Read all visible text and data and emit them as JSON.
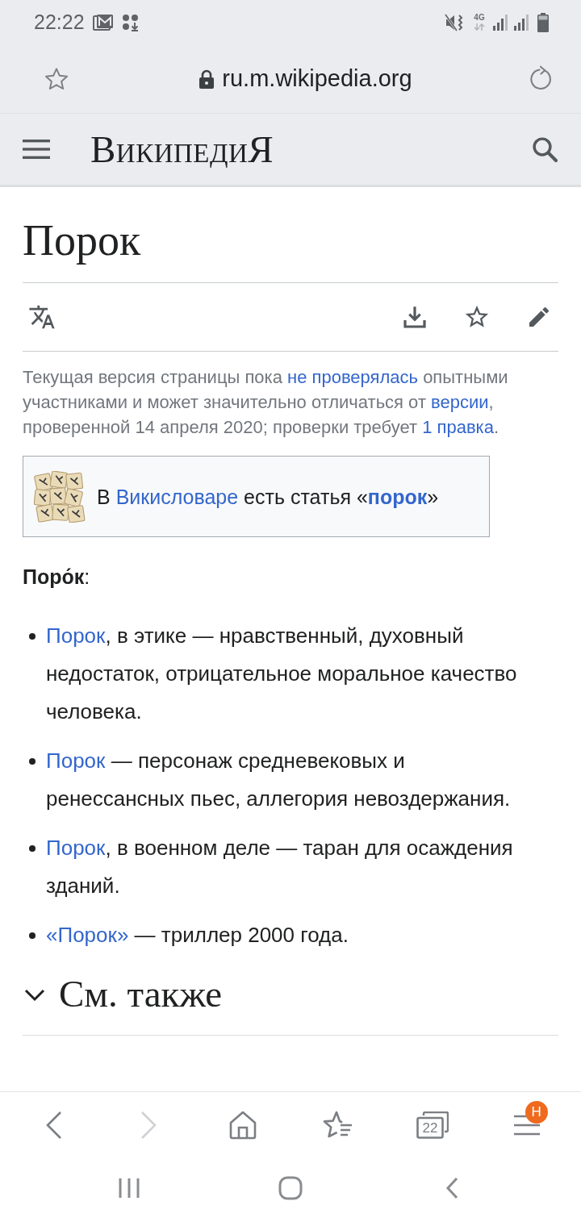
{
  "status_bar": {
    "time": "22:22",
    "network": "4G"
  },
  "address_bar": {
    "url": "ru.m.wikipedia.org"
  },
  "wiki_header": {
    "logo": "ВикипедиЯ"
  },
  "article": {
    "title": "Порок",
    "notice": [
      {
        "kind": "text",
        "text": "Текущая версия страницы пока "
      },
      {
        "kind": "link",
        "text": "не проверялась"
      },
      {
        "kind": "text",
        "text": " опытными участниками и может значительно отличаться от "
      },
      {
        "kind": "link",
        "text": "версии"
      },
      {
        "kind": "text",
        "text": ", проверенной 14 апреля 2020; проверки требует "
      },
      {
        "kind": "link",
        "text": "1 правка"
      },
      {
        "kind": "text",
        "text": "."
      }
    ],
    "wiktionary_box": [
      {
        "kind": "text",
        "text": "В "
      },
      {
        "kind": "link",
        "text": "Викисловаре"
      },
      {
        "kind": "text",
        "text": " есть статья «"
      },
      {
        "kind": "bold_link",
        "text": "порок"
      },
      {
        "kind": "text",
        "text": "»"
      }
    ],
    "definition": "**Поро́к**:",
    "items": [
      {
        "segments": [
          {
            "kind": "link",
            "text": "Порок"
          },
          {
            "kind": "text",
            "text": ", в этике — нравственный, духовный недостаток, отрицательное моральное качество человека."
          }
        ]
      },
      {
        "segments": [
          {
            "kind": "link",
            "text": "Порок"
          },
          {
            "kind": "text",
            "text": " — персонаж средневековых и ренессансных пьес, аллегория невоздержания."
          }
        ]
      },
      {
        "segments": [
          {
            "kind": "link",
            "text": "Порок"
          },
          {
            "kind": "text",
            "text": ", в военном деле — таран для осаждения зданий."
          }
        ]
      },
      {
        "segments": [
          {
            "kind": "link",
            "text": "«Порок»"
          },
          {
            "kind": "text",
            "text": " — триллер 2000 года."
          }
        ]
      }
    ],
    "sections": [
      {
        "title": "См. также",
        "expanded": false
      }
    ]
  },
  "toolbar": [
    {
      "kind": "back",
      "disabled": false
    },
    {
      "kind": "forward",
      "disabled": true
    },
    {
      "kind": "home",
      "disabled": false
    },
    {
      "kind": "bookmarks",
      "disabled": false
    },
    {
      "kind": "tabs",
      "disabled": false,
      "label": "22"
    },
    {
      "kind": "menu",
      "disabled": false,
      "badge": "H"
    }
  ]
}
